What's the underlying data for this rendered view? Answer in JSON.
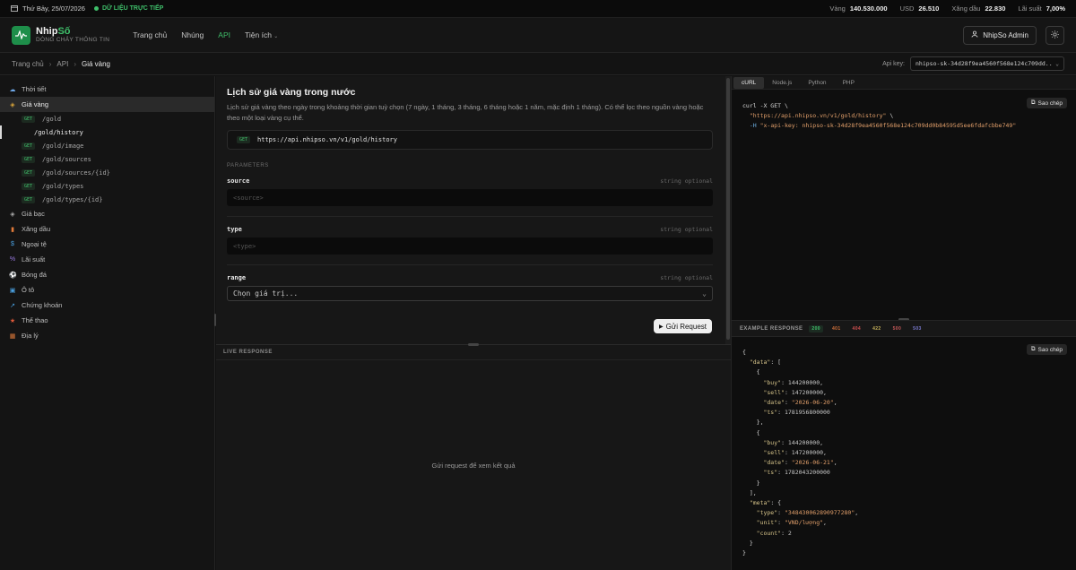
{
  "ticker": {
    "date": "Thứ Bảy, 25/07/2026",
    "live_label": "DỮ LIỆU TRỰC TIẾP",
    "stats": [
      {
        "label": "Vàng",
        "value": "140.530.000"
      },
      {
        "label": "USD",
        "value": "26.510"
      },
      {
        "label": "Xăng dầu",
        "value": "22.830"
      },
      {
        "label": "Lãi suất",
        "value": "7,00%"
      }
    ]
  },
  "header": {
    "brand_name_a": "Nhip",
    "brand_name_b": "Số",
    "brand_tagline": "DÒNG CHẢY THÔNG TIN",
    "nav": [
      "Trang chủ",
      "Nhúng",
      "API",
      "Tiện ích"
    ],
    "nav_active": "API",
    "admin_label": "NhipSo Admin"
  },
  "breadcrumb": {
    "items": [
      "Trang chủ",
      "API",
      "Giá vàng"
    ],
    "api_key_label": "Api key:",
    "api_key_value": "nhipso-sk-34d28f9ea4560f568e124c709dd..."
  },
  "sidebar": {
    "items": [
      {
        "label": "Thời tiết",
        "icon": "cloud-icon"
      },
      {
        "label": "Giá vàng",
        "icon": "gold-icon"
      },
      {
        "label": "Giá bạc",
        "icon": "silver-icon"
      },
      {
        "label": "Xăng dầu",
        "icon": "fuel-icon"
      },
      {
        "label": "Ngoại tệ",
        "icon": "dollar-icon"
      },
      {
        "label": "Lãi suất",
        "icon": "percent-icon"
      },
      {
        "label": "Bóng đá",
        "icon": "ball-icon"
      },
      {
        "label": "Ô tô",
        "icon": "car-icon"
      },
      {
        "label": "Chứng khoán",
        "icon": "chart-icon"
      },
      {
        "label": "Thể thao",
        "icon": "trophy-icon"
      },
      {
        "label": "Địa lý",
        "icon": "map-icon"
      }
    ],
    "gold_endpoints": [
      {
        "method": "GET",
        "path": "/gold"
      },
      {
        "method": "",
        "path": "/gold/history"
      },
      {
        "method": "GET",
        "path": "/gold/image"
      },
      {
        "method": "GET",
        "path": "/gold/sources"
      },
      {
        "method": "GET",
        "path": "/gold/sources/{id}"
      },
      {
        "method": "GET",
        "path": "/gold/types"
      },
      {
        "method": "GET",
        "path": "/gold/types/{id}"
      }
    ]
  },
  "endpoint": {
    "title": "Lịch sử giá vàng trong nước",
    "description": "Lịch sử giá vàng theo ngày trong khoảng thời gian tuỳ chọn (7 ngày, 1 tháng, 3 tháng, 6 tháng hoặc 1 năm, mặc định 1 tháng). Có thể lọc theo nguồn vàng hoặc theo một loại vàng cụ thể.",
    "method": "GET",
    "url": "https://api.nhipso.vn/v1/gold/history",
    "params_title": "PARAMETERS",
    "params": [
      {
        "name": "source",
        "type": "string optional",
        "placeholder": "<source>"
      },
      {
        "name": "type",
        "type": "string optional",
        "placeholder": "<type>"
      },
      {
        "name": "range",
        "type": "string optional",
        "select_value": "Chọn giá trị..."
      }
    ],
    "send_label": "Gửi Request"
  },
  "live": {
    "title": "LIVE RESPONSE",
    "empty_text": "Gửi request để xem kết quả"
  },
  "code_panel": {
    "tabs": [
      "cURL",
      "Node.js",
      "Python",
      "PHP"
    ],
    "active_tab": "cURL",
    "copy_label": "Sao chép",
    "curl_line1": "curl -X GET \\",
    "curl_url": "\"https://api.nhipso.vn/v1/gold/history\"",
    "curl_url_tail": " \\",
    "curl_flag": "-H",
    "curl_header": "\"x-api-key: nhipso-sk-34d28f9ea4560f568e124c709dd0b84595d5ee6fdafcbbe749\""
  },
  "example": {
    "title": "EXAMPLE RESPONSE",
    "codes": [
      "200",
      "401",
      "404",
      "422",
      "500",
      "503"
    ],
    "copy_label": "Sao chép",
    "data": [
      {
        "buy": "144200000",
        "sell": "147200000",
        "date": "\"2026-06-20\"",
        "ts": "1781956800000"
      },
      {
        "buy": "144200000",
        "sell": "147200000",
        "date": "\"2026-06-21\"",
        "ts": "1782043200000"
      }
    ],
    "meta": {
      "type": "\"348430062890977280\"",
      "unit": "\"VND/lượng\"",
      "count": "2"
    }
  },
  "colors": {
    "accent": "#3fbf6a",
    "background": "#111111",
    "logo_bg": "#1e8e4a"
  }
}
